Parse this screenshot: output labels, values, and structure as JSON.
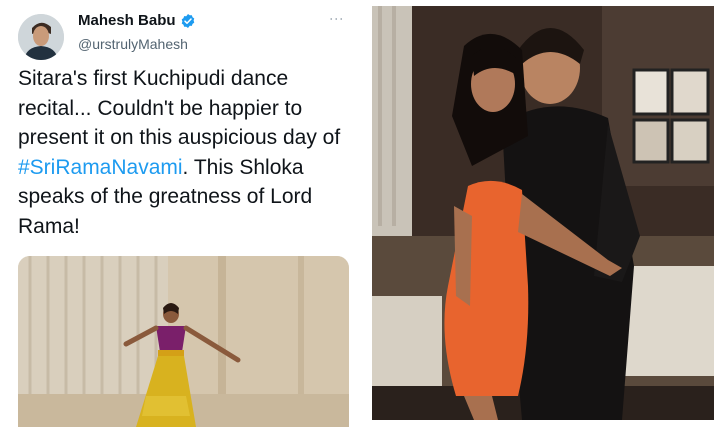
{
  "tweet": {
    "author_name": "Mahesh Babu",
    "author_handle": "@urstrulyMahesh",
    "text_before": "Sitara's first Kuchipudi dance recital... Couldn't be happier to present it on this auspicious day of ",
    "hashtag": "#SriRamaNavami",
    "text_after": ". This Shloka speaks of the greatness of Lord Rama!",
    "more_icon": "more-vertical-icon",
    "verified_icon": "verified-badge-icon"
  },
  "colors": {
    "text": "#0f1419",
    "secondary": "#536471",
    "link": "#1d9bf0",
    "verified": "#1d9bf0"
  }
}
